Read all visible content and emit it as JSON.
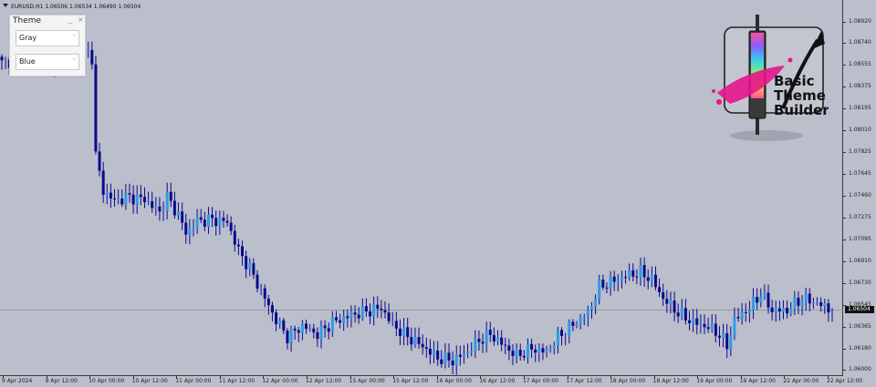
{
  "symbol_info": "EURUSD,H1  1.06506 1.06534 1.06490 1.06504",
  "theme_panel": {
    "title": "Theme",
    "minimize_label": "_",
    "close_label": "×",
    "dropdown1": {
      "value": "Gray",
      "caret": "˅"
    },
    "dropdown2": {
      "value": "Blue",
      "caret": "˅"
    }
  },
  "logo": {
    "line1": "Basic",
    "line2": "Theme",
    "line3": "Builder"
  },
  "colors": {
    "background": "#bbbecb",
    "bull_candle": "#2e9ce6",
    "bear_candle": "#0a0a8c",
    "wick": "#0a0a8c",
    "bid_line": "#8a8d99"
  },
  "price_axis": {
    "labels": [
      "1.08920",
      "1.08740",
      "1.08555",
      "1.08375",
      "1.08195",
      "1.08010",
      "1.07825",
      "1.07645",
      "1.07460",
      "1.07275",
      "1.07095",
      "1.06910",
      "1.06730",
      "1.06545",
      "1.06365",
      "1.06180",
      "1.06000"
    ],
    "current_price": "1.06504"
  },
  "time_axis": {
    "labels": [
      "9 Apr 2024",
      "9 Apr 12:00",
      "10 Apr 00:00",
      "10 Apr 12:00",
      "11 Apr 00:00",
      "11 Apr 12:00",
      "12 Apr 00:00",
      "12 Apr 12:00",
      "15 Apr 00:00",
      "15 Apr 12:00",
      "16 Apr 00:00",
      "16 Apr 12:00",
      "17 Apr 00:00",
      "17 Apr 12:00",
      "18 Apr 00:00",
      "18 Apr 12:00",
      "19 Apr 00:00",
      "19 Apr 12:00",
      "22 Apr 00:00",
      "22 Apr 12:00"
    ]
  },
  "chart_data": {
    "type": "candlestick",
    "symbol": "EURUSD",
    "timeframe": "H1",
    "ylim": [
      1.0595,
      1.091
    ],
    "bid": 1.06504,
    "close_path": [
      [
        0,
        1.0857
      ],
      [
        5,
        1.0862
      ],
      [
        9,
        1.0856
      ],
      [
        14,
        1.086
      ],
      [
        18,
        1.0856
      ],
      [
        21,
        1.0863
      ],
      [
        23,
        1.0866
      ],
      [
        24,
        1.0862
      ],
      [
        25,
        1.078
      ],
      [
        27,
        1.075
      ],
      [
        30,
        1.0742
      ],
      [
        34,
        1.0745
      ],
      [
        38,
        1.0743
      ],
      [
        42,
        1.0732
      ],
      [
        44,
        1.0745
      ],
      [
        47,
        1.073
      ],
      [
        49,
        1.0715
      ],
      [
        52,
        1.0725
      ],
      [
        56,
        1.0726
      ],
      [
        60,
        1.0724
      ],
      [
        63,
        1.07
      ],
      [
        66,
        1.0685
      ],
      [
        70,
        1.066
      ],
      [
        73,
        1.0642
      ],
      [
        76,
        1.0628
      ],
      [
        80,
        1.0637
      ],
      [
        84,
        1.063
      ],
      [
        88,
        1.064
      ],
      [
        93,
        1.0646
      ],
      [
        98,
        1.065
      ],
      [
        101,
        1.0652
      ],
      [
        104,
        1.0638
      ],
      [
        108,
        1.0628
      ],
      [
        112,
        1.062
      ],
      [
        116,
        1.061
      ],
      [
        120,
        1.0608
      ],
      [
        124,
        1.0615
      ],
      [
        127,
        1.0625
      ],
      [
        130,
        1.063
      ],
      [
        133,
        1.0622
      ],
      [
        137,
        1.0612
      ],
      [
        141,
        1.0618
      ],
      [
        145,
        1.0615
      ],
      [
        148,
        1.0628
      ],
      [
        152,
        1.0638
      ],
      [
        156,
        1.0648
      ],
      [
        159,
        1.067
      ],
      [
        163,
        1.0675
      ],
      [
        167,
        1.068
      ],
      [
        170,
        1.0682
      ],
      [
        173,
        1.0676
      ],
      [
        176,
        1.066
      ],
      [
        180,
        1.0648
      ],
      [
        184,
        1.064
      ],
      [
        188,
        1.0636
      ],
      [
        191,
        1.063
      ],
      [
        193,
        1.062
      ],
      [
        195,
        1.0642
      ],
      [
        199,
        1.0652
      ],
      [
        202,
        1.0664
      ],
      [
        205,
        1.065
      ],
      [
        209,
        1.065
      ],
      [
        213,
        1.066
      ],
      [
        217,
        1.0656
      ],
      [
        221,
        1.065
      ]
    ]
  }
}
